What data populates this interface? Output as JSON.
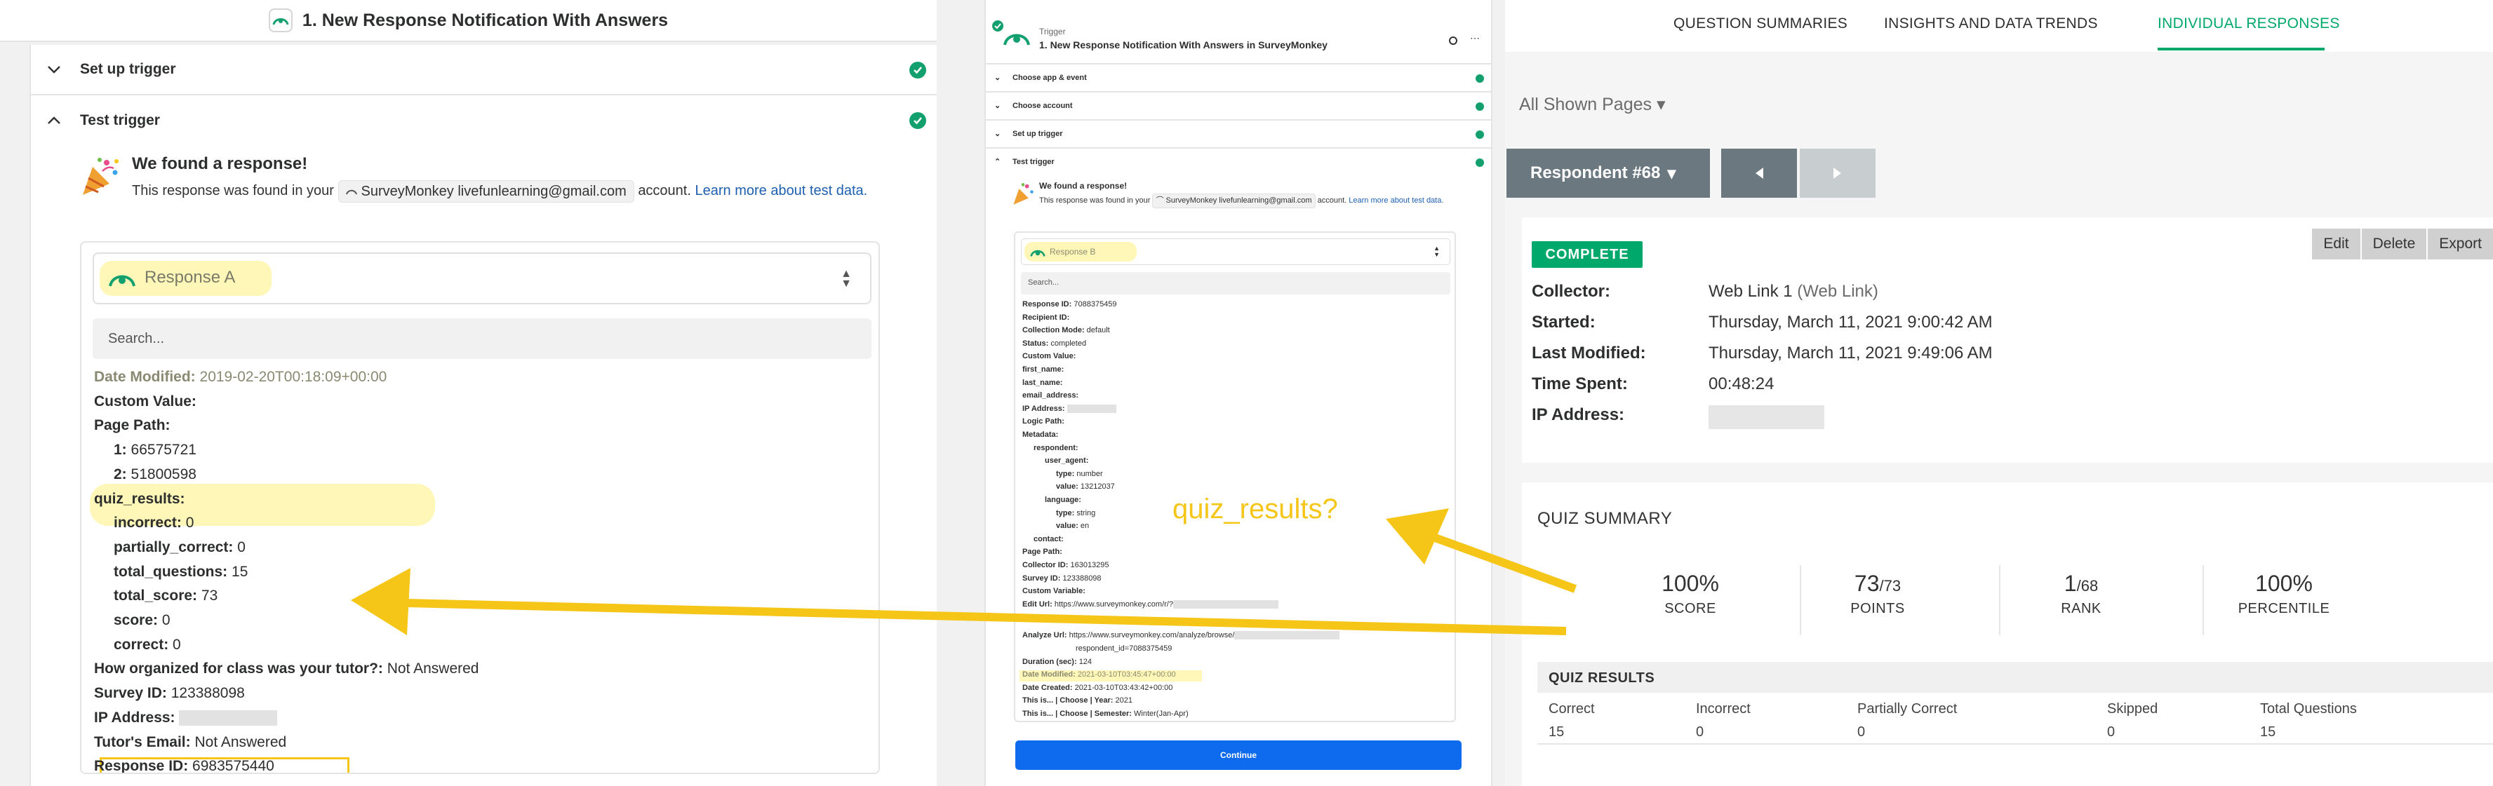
{
  "left": {
    "title": "1. New Response Notification With Answers",
    "sections": {
      "setup_trigger": "Set up trigger",
      "test_trigger": "Test trigger"
    },
    "found": {
      "title": "We found a response!",
      "prefix": "This response was found in your",
      "account": "SurveyMonkey livefunlearning@gmail.com",
      "suffix": "account.",
      "link": "Learn more about test data."
    },
    "response_select": "Response A",
    "search_placeholder": "Search...",
    "fields": [
      {
        "label": "Date Modified:",
        "value": "2019-02-20T00:18:09+00:00"
      },
      {
        "label": "Custom Value:",
        "value": ""
      },
      {
        "label": "Page Path:",
        "value": ""
      },
      {
        "label": "1:",
        "value": "66575721"
      },
      {
        "label": "2:",
        "value": "51800598"
      },
      {
        "label": "quiz_results:",
        "value": ""
      },
      {
        "label": "incorrect:",
        "value": "0"
      },
      {
        "label": "partially_correct:",
        "value": "0"
      },
      {
        "label": "total_questions:",
        "value": "15"
      },
      {
        "label": "total_score:",
        "value": "73"
      },
      {
        "label": "score:",
        "value": "0"
      },
      {
        "label": "correct:",
        "value": "0"
      },
      {
        "label": "How organized for class was your tutor?:",
        "value": "Not Answered"
      },
      {
        "label": "Survey ID:",
        "value": "123388098"
      },
      {
        "label": "IP Address:",
        "value": ""
      },
      {
        "label": "Tutor's Email:",
        "value": "Not Answered"
      },
      {
        "label": "Response ID:",
        "value": "6983575440"
      }
    ]
  },
  "middle": {
    "subtitle": "Trigger",
    "title": "1. New Response Notification With Answers in SurveyMonkey",
    "sections": [
      "Choose app & event",
      "Choose account",
      "Set up trigger",
      "Test trigger"
    ],
    "found": {
      "title": "We found a response!",
      "prefix": "This response was found in your",
      "account": "SurveyMonkey livefunlearning@gmail.com",
      "suffix": "account.",
      "link": "Learn more about test data."
    },
    "response_select": "Response B",
    "search_placeholder": "Search...",
    "fields": [
      {
        "label": "Response ID:",
        "value": "7088375459"
      },
      {
        "label": "Recipient ID:",
        "value": ""
      },
      {
        "label": "Collection Mode:",
        "value": "default"
      },
      {
        "label": "Status:",
        "value": "completed"
      },
      {
        "label": "Custom Value:",
        "value": ""
      },
      {
        "label": "first_name:",
        "value": ""
      },
      {
        "label": "last_name:",
        "value": ""
      },
      {
        "label": "email_address:",
        "value": ""
      },
      {
        "label": "IP Address:",
        "value": ""
      },
      {
        "label": "Logic Path:",
        "value": ""
      },
      {
        "label": "Metadata:",
        "value": ""
      },
      {
        "label": "respondent:",
        "value": ""
      },
      {
        "label": "user_agent:",
        "value": ""
      },
      {
        "label": "type:",
        "value": "number"
      },
      {
        "label": "value:",
        "value": "13212037"
      },
      {
        "label": "language:",
        "value": ""
      },
      {
        "label": "type:",
        "value": "string"
      },
      {
        "label": "value:",
        "value": "en"
      },
      {
        "label": "contact:",
        "value": ""
      },
      {
        "label": "Page Path:",
        "value": ""
      },
      {
        "label": "Collector ID:",
        "value": "163013295"
      },
      {
        "label": "Survey ID:",
        "value": "123388098"
      },
      {
        "label": "Custom Variable:",
        "value": ""
      },
      {
        "label": "Edit Url:",
        "value": "https://www.surveymonkey.com/r/?"
      },
      {
        "label": "Analyze Url:",
        "value": "https://www.surveymonkey.com/analyze/browse/"
      },
      {
        "label": "",
        "value": "respondent_id=7088375459"
      },
      {
        "label": "Duration (sec):",
        "value": "124"
      },
      {
        "label": "Date Modified:",
        "value": "2021-03-10T03:45:47+00:00"
      },
      {
        "label": "Date Created:",
        "value": "2021-03-10T03:43:42+00:00"
      },
      {
        "label": "This is... | Choose | Year:",
        "value": "2021"
      },
      {
        "label": "This is... | Choose | Semester:",
        "value": "Winter(Jan-Apr)"
      }
    ],
    "continue_label": "Continue"
  },
  "right": {
    "tabs": [
      "QUESTION SUMMARIES",
      "INSIGHTS AND DATA TRENDS",
      "INDIVIDUAL RESPONSES"
    ],
    "active_tab": "INDIVIDUAL RESPONSES",
    "pages_filter": "All Shown Pages",
    "respondent": "Respondent #68",
    "status_badge": "COMPLETE",
    "actions": [
      "Edit",
      "Delete",
      "Export"
    ],
    "details": [
      {
        "label": "Collector:",
        "value": "Web Link 1",
        "extra": "(Web Link)"
      },
      {
        "label": "Started:",
        "value": "Thursday, March 11, 2021 9:00:42 AM",
        "extra": ""
      },
      {
        "label": "Last Modified:",
        "value": "Thursday, March 11, 2021 9:49:06 AM",
        "extra": ""
      },
      {
        "label": "Time Spent:",
        "value": "00:48:24",
        "extra": ""
      },
      {
        "label": "IP Address:",
        "value": "",
        "extra": ""
      }
    ],
    "quiz_summary_title": "QUIZ SUMMARY",
    "stats": [
      {
        "value": "100%",
        "suffix": "",
        "label": "SCORE"
      },
      {
        "value": "73",
        "suffix": "/73",
        "label": "POINTS"
      },
      {
        "value": "1",
        "suffix": "/68",
        "label": "RANK"
      },
      {
        "value": "100%",
        "suffix": "",
        "label": "PERCENTILE"
      }
    ],
    "quiz_results_title": "QUIZ RESULTS",
    "results_columns": [
      "Correct",
      "Incorrect",
      "Partially Correct",
      "Skipped",
      "Total Questions"
    ],
    "results_values": [
      "15",
      "0",
      "0",
      "0",
      "15"
    ]
  },
  "annotation": {
    "question_text": "quiz_results?",
    "color": "#f5c518"
  },
  "colors": {
    "zapier_green": "#13a06f",
    "sm_green": "#00a86b",
    "highlight": "#fff7b8",
    "continue_blue": "#0f6bed"
  }
}
